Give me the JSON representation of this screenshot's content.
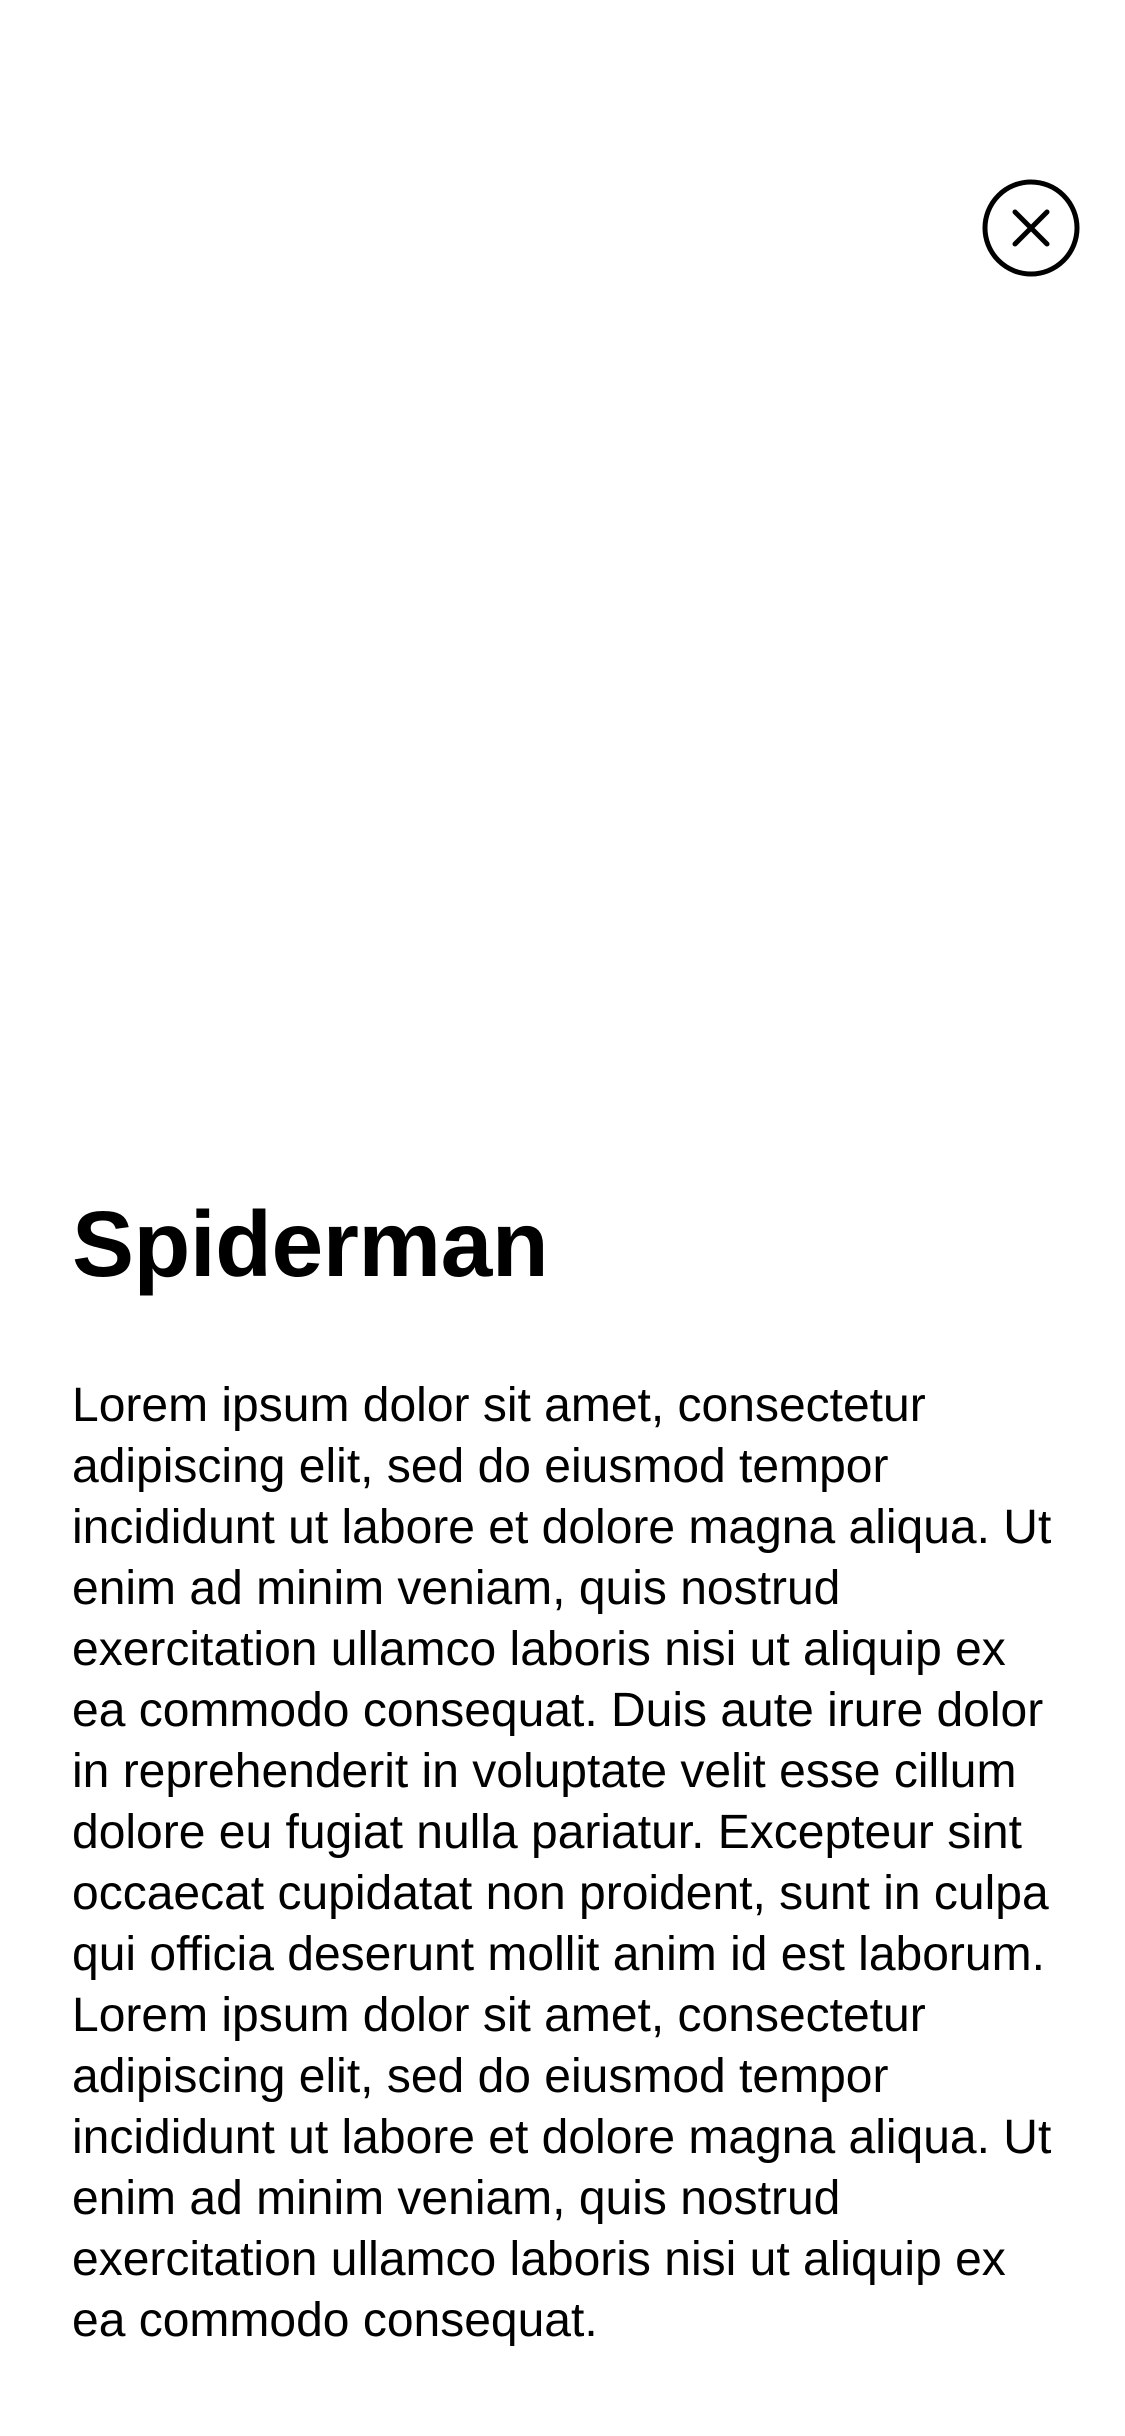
{
  "detail": {
    "title": "Spiderman",
    "description": "Lorem ipsum dolor sit amet, consectetur adipiscing elit, sed do eiusmod tempor incididunt ut labore et dolore magna aliqua. Ut enim ad minim veniam, quis nostrud exercitation ullamco laboris nisi ut aliquip ex ea commodo consequat. Duis aute irure dolor in reprehenderit in voluptate velit esse cillum dolore eu fugiat nulla pariatur. Excepteur sint occaecat cupidatat non proident, sunt in culpa qui officia deserunt mollit anim id est laborum. Lorem ipsum dolor sit amet, consectetur adipiscing elit, sed do eiusmod tempor incididunt ut labore et dolore magna aliqua. Ut enim ad minim veniam, quis nostrud exercitation ullamco laboris nisi ut aliquip ex ea commodo consequat."
  },
  "close_button": {
    "icon": "close-circle-icon"
  },
  "colors": {
    "background": "#ffffff",
    "text": "#000000",
    "icon_stroke": "#000000"
  }
}
